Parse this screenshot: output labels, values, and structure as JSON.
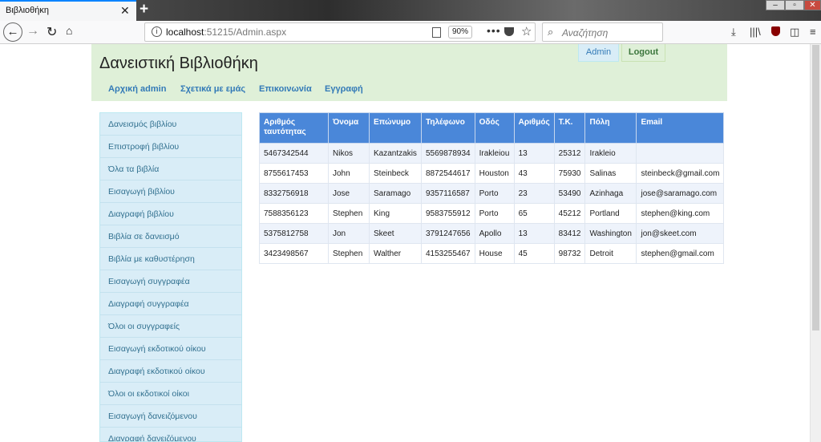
{
  "browser": {
    "tab_title": "Βιβλιοθήκη",
    "tab_close": "✕",
    "new_tab": "+",
    "url_host": "localhost",
    "url_rest": ":51215/Admin.aspx",
    "zoom": "90%",
    "search_placeholder": "Αναζήτηση"
  },
  "header": {
    "title": "Δανειστική Βιβλιοθήκη",
    "nav": [
      "Αρχική admin",
      "Σχετικά με εμάς",
      "Επικοινωνία",
      "Εγγραφή"
    ],
    "admin_label": "Admin",
    "logout_label": "Logout"
  },
  "sidebar": {
    "items": [
      "Δανεισμός βιβλίου",
      "Επιστροφή βιβλίου",
      "Όλα τα βιβλία",
      "Εισαγωγή βιβλίου",
      "Διαγραφή βιβλίου",
      "Βιβλία σε δανεισμό",
      "Βιβλία με καθυστέρηση",
      "Εισαγωγή συγγραφέα",
      "Διαγραφή συγγραφέα",
      "Όλοι οι συγγραφείς",
      "Εισαγωγή εκδοτικού οίκου",
      "Διαγραφή εκδοτικού οίκου",
      "Όλοι οι εκδοτικοί οίκοι",
      "Εισαγωγή δανειζόμενου",
      "Διαγραφή δανειζόμενου"
    ]
  },
  "table": {
    "headers": [
      "Αριθμός ταυτότητας",
      "Όνομα",
      "Επώνυμο",
      "Τηλέφωνο",
      "Οδός",
      "Αριθμός",
      "Τ.Κ.",
      "Πόλη",
      "Email"
    ],
    "rows": [
      [
        "5467342544",
        "Nikos",
        "Kazantzakis",
        "5569878934",
        "Irakleiou",
        "13",
        "25312",
        "Irakleio",
        ""
      ],
      [
        "8755617453",
        "John",
        "Steinbeck",
        "8872544617",
        "Houston",
        "43",
        "75930",
        "Salinas",
        "steinbeck@gmail.com"
      ],
      [
        "8332756918",
        "Jose",
        "Saramago",
        "9357116587",
        "Porto",
        "23",
        "53490",
        "Azinhaga",
        "jose@saramago.com"
      ],
      [
        "7588356123",
        "Stephen",
        "King",
        "9583755912",
        "Porto",
        "65",
        "45212",
        "Portland",
        "stephen@king.com"
      ],
      [
        "5375812758",
        "Jon",
        "Skeet",
        "3791247656",
        "Apollo",
        "13",
        "83412",
        "Washington",
        "jon@skeet.com"
      ],
      [
        "3423498567",
        "Stephen",
        "Walther",
        "4153255467",
        "House",
        "45",
        "98732",
        "Detroit",
        "stephen@gmail.com"
      ]
    ]
  }
}
